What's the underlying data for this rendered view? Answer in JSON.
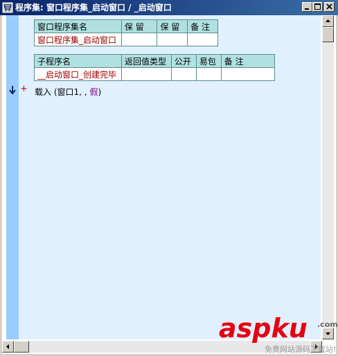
{
  "window": {
    "title": "程序集: 窗口程序集_启动窗口 / _启动窗口"
  },
  "assembly_table": {
    "headers": [
      "窗口程序集名",
      "保 留",
      "保 留",
      "备 注"
    ],
    "row": [
      "窗口程序集_启动窗口",
      "",
      "",
      ""
    ]
  },
  "sub_table": {
    "headers": [
      "子程序名",
      "返回值类型",
      "公开",
      "易包",
      "备 注"
    ],
    "row": [
      "__启动窗口_创建完毕",
      "",
      "",
      "",
      ""
    ]
  },
  "code": {
    "keyword": "载入",
    "open_paren": " (",
    "arg1": "窗口1",
    "sep": ", ",
    "arg2": "",
    "sep2": ", ",
    "arg3": "假",
    "close_paren": ")"
  },
  "watermark": {
    "main": "aspku",
    "dotcom": ".com",
    "sub": "免费网站源码下载站!"
  }
}
